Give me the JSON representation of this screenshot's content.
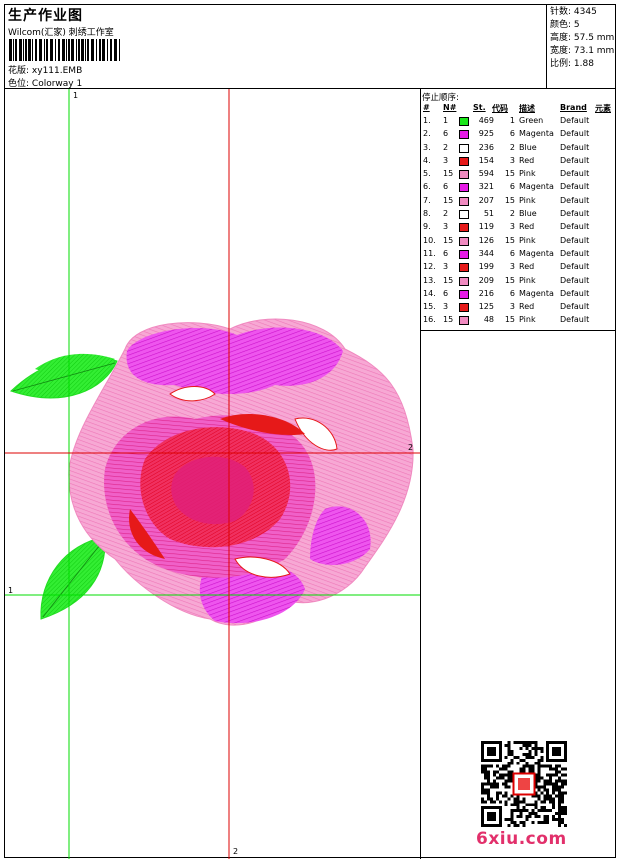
{
  "header": {
    "title": "生产作业图",
    "company": "Wilcom(汇家) 刺绣工作室",
    "design_label": "花版:",
    "design_name": "xy111.EMB",
    "colorway_label": "色位:",
    "colorway_name": "Colorway 1"
  },
  "stats": {
    "stitches": "针数: 4345",
    "colors": "颜色: 5",
    "height": "高度: 57.5 mm",
    "width": "宽度: 73.1 mm",
    "scale": "比例: 1.88"
  },
  "stop_sequence": {
    "title": "停止顺序:",
    "columns": [
      "#",
      "N#",
      "St.",
      "代码",
      "描述",
      "Brand",
      "元素"
    ],
    "rows": [
      {
        "idx": "1.",
        "n": "1",
        "st": "469",
        "code": "1",
        "desc": "Green",
        "brand": "Default",
        "color": "#19e619"
      },
      {
        "idx": "2.",
        "n": "6",
        "st": "925",
        "code": "6",
        "desc": "Magenta",
        "brand": "Default",
        "color": "#e619e6"
      },
      {
        "idx": "3.",
        "n": "2",
        "st": "236",
        "code": "2",
        "desc": "Blue",
        "brand": "Default",
        "color": "#ffffff"
      },
      {
        "idx": "4.",
        "n": "3",
        "st": "154",
        "code": "3",
        "desc": "Red",
        "brand": "Default",
        "color": "#e61919"
      },
      {
        "idx": "5.",
        "n": "15",
        "st": "594",
        "code": "15",
        "desc": "Pink",
        "brand": "Default",
        "color": "#f08ac0"
      },
      {
        "idx": "6.",
        "n": "6",
        "st": "321",
        "code": "6",
        "desc": "Magenta",
        "brand": "Default",
        "color": "#e619e6"
      },
      {
        "idx": "7.",
        "n": "15",
        "st": "207",
        "code": "15",
        "desc": "Pink",
        "brand": "Default",
        "color": "#f08ac0"
      },
      {
        "idx": "8.",
        "n": "2",
        "st": "51",
        "code": "2",
        "desc": "Blue",
        "brand": "Default",
        "color": "#ffffff"
      },
      {
        "idx": "9.",
        "n": "3",
        "st": "119",
        "code": "3",
        "desc": "Red",
        "brand": "Default",
        "color": "#e61919"
      },
      {
        "idx": "10.",
        "n": "15",
        "st": "126",
        "code": "15",
        "desc": "Pink",
        "brand": "Default",
        "color": "#f08ac0"
      },
      {
        "idx": "11.",
        "n": "6",
        "st": "344",
        "code": "6",
        "desc": "Magenta",
        "brand": "Default",
        "color": "#e619e6"
      },
      {
        "idx": "12.",
        "n": "3",
        "st": "199",
        "code": "3",
        "desc": "Red",
        "brand": "Default",
        "color": "#e61919"
      },
      {
        "idx": "13.",
        "n": "15",
        "st": "209",
        "code": "15",
        "desc": "Pink",
        "brand": "Default",
        "color": "#f08ac0"
      },
      {
        "idx": "14.",
        "n": "6",
        "st": "216",
        "code": "6",
        "desc": "Magenta",
        "brand": "Default",
        "color": "#e619e6"
      },
      {
        "idx": "15.",
        "n": "3",
        "st": "125",
        "code": "3",
        "desc": "Red",
        "brand": "Default",
        "color": "#e61919"
      },
      {
        "idx": "16.",
        "n": "15",
        "st": "48",
        "code": "15",
        "desc": "Pink",
        "brand": "Default",
        "color": "#f08ac0"
      }
    ]
  },
  "axis_labels": {
    "v_green_top": "1",
    "h_green_left": "1",
    "h_red_right": "2",
    "v_red_bottom": "2"
  },
  "colors": {
    "green_guide": "#00dd00",
    "red_guide": "#dd0000"
  },
  "watermark": {
    "site": "6xiu.com"
  }
}
